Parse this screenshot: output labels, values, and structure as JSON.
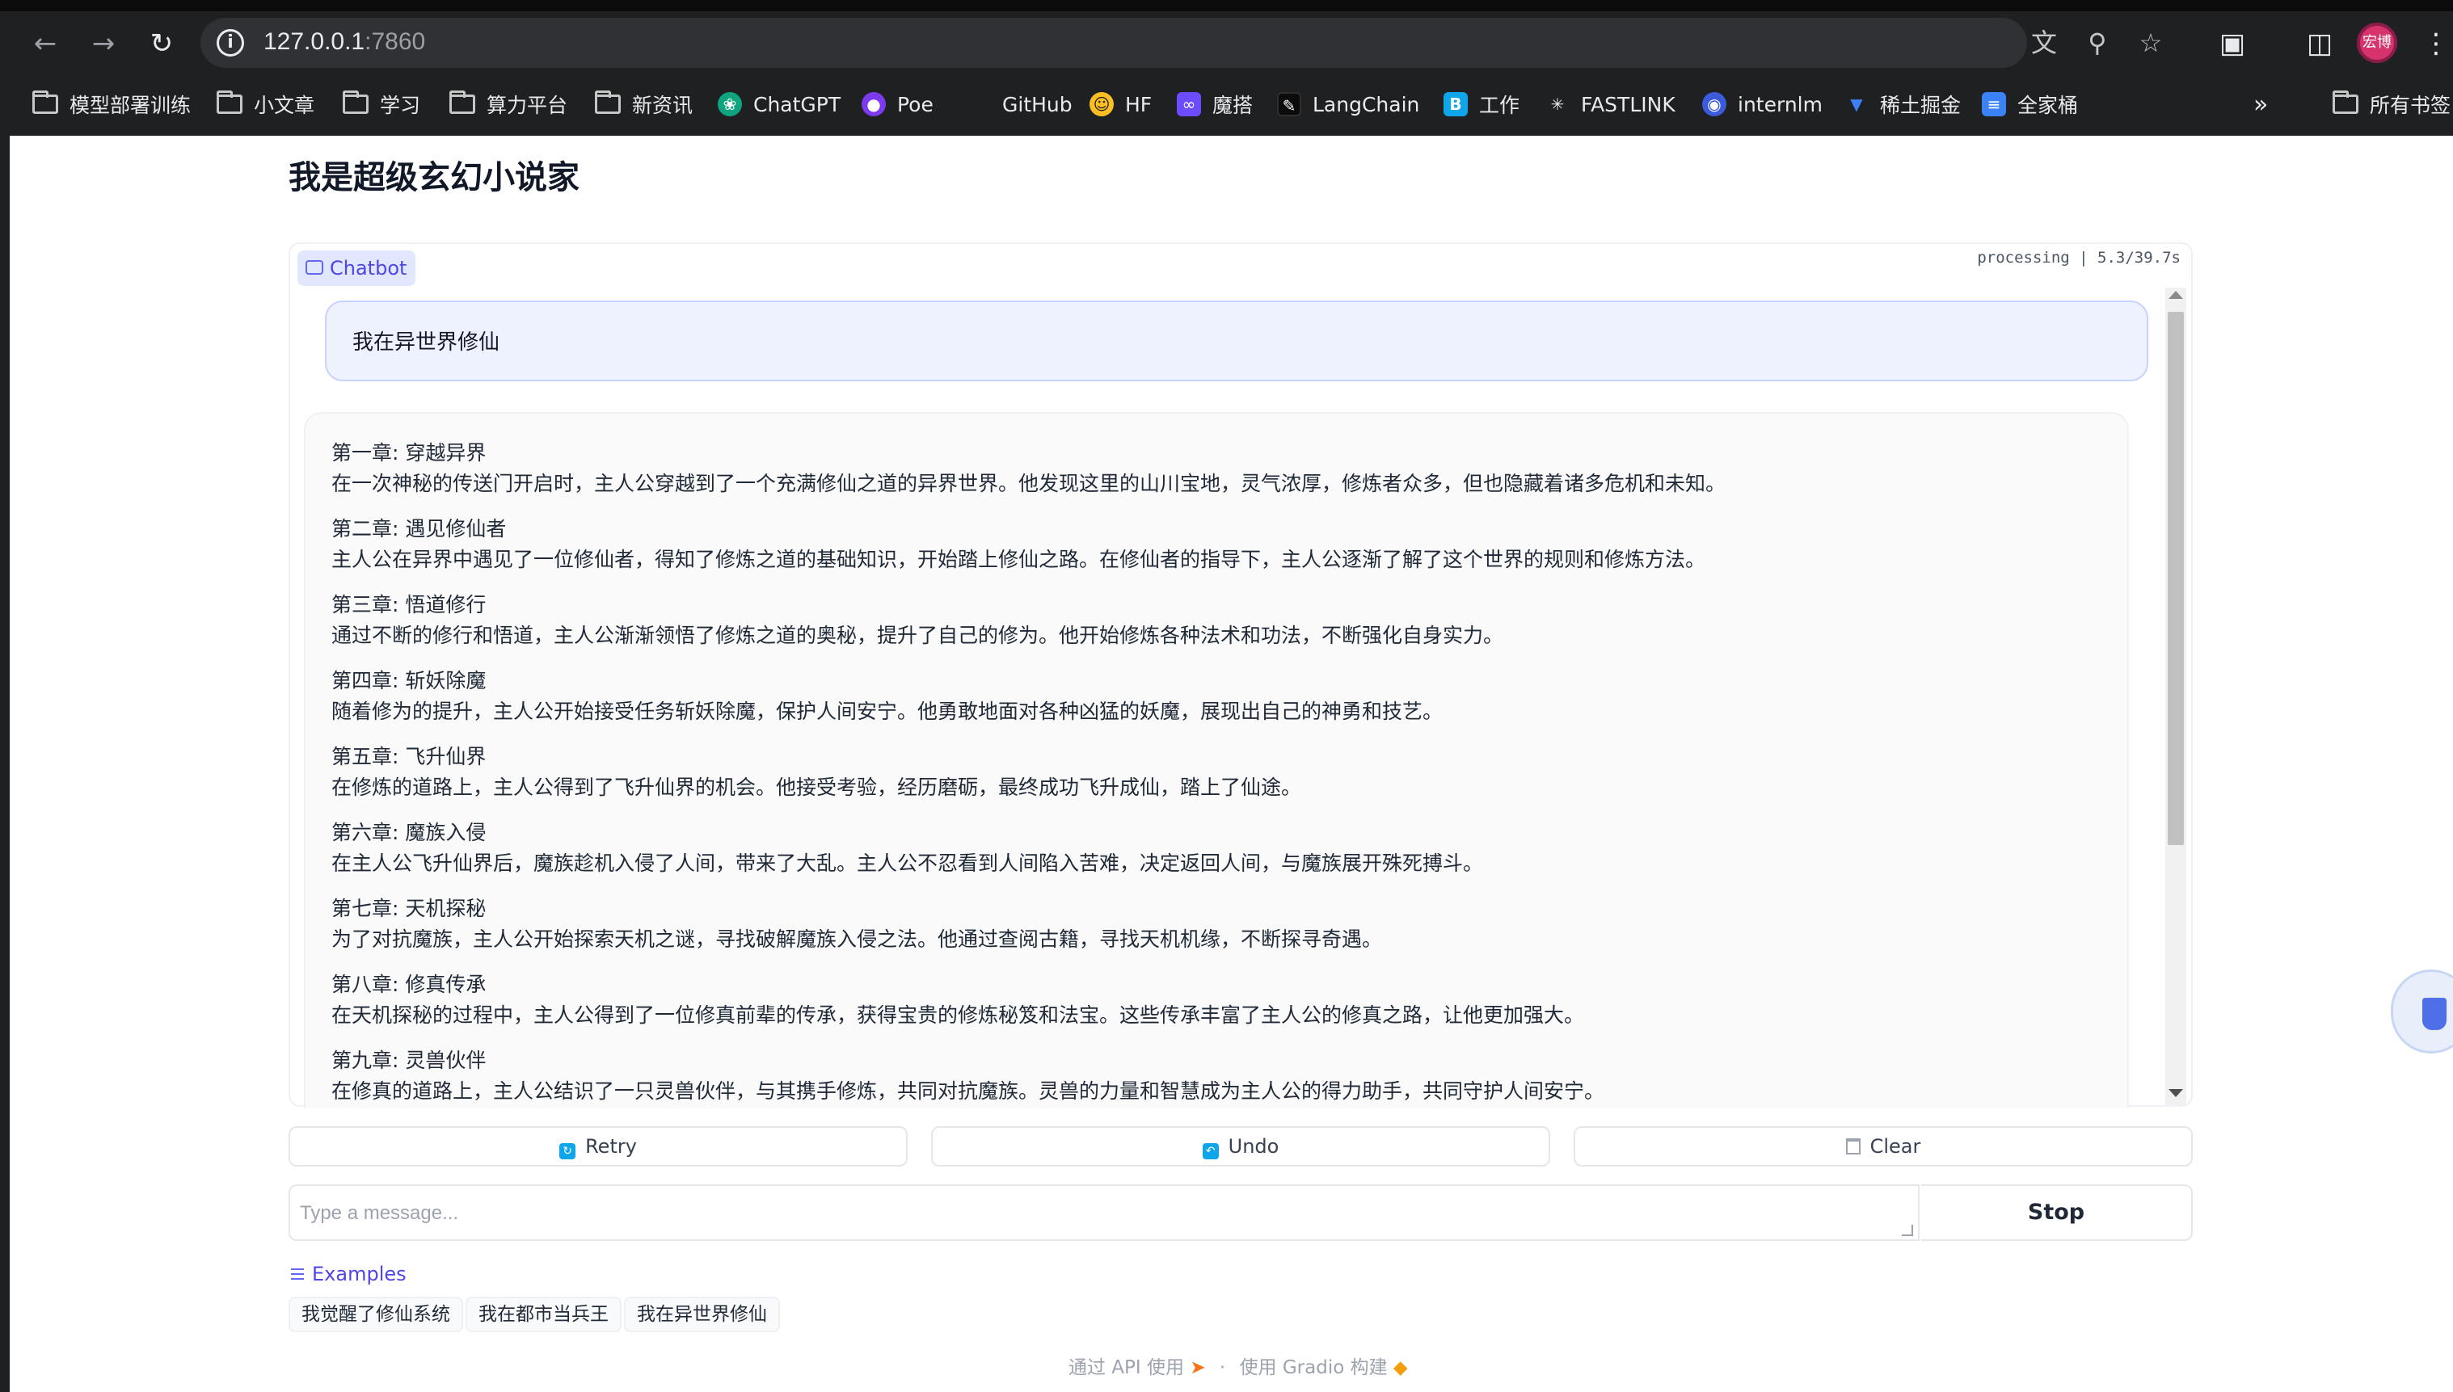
{
  "browser": {
    "url_host": "127.0.0.1",
    "url_port": ":7860",
    "avatar_text": "宏博",
    "bookmarks": [
      {
        "label": "模型部署训练",
        "icon": "folder-icon"
      },
      {
        "label": "小文章",
        "icon": "folder-icon"
      },
      {
        "label": "学习",
        "icon": "folder-icon"
      },
      {
        "label": "算力平台",
        "icon": "folder-icon"
      },
      {
        "label": "新资讯",
        "icon": "folder-icon"
      },
      {
        "label": "ChatGPT",
        "icon": "chatgpt-icon"
      },
      {
        "label": "Poe",
        "icon": "poe-icon"
      },
      {
        "label": "GitHub",
        "icon": "github-icon"
      },
      {
        "label": "HF",
        "icon": "huggingface-icon"
      },
      {
        "label": "魔搭",
        "icon": "modelscope-icon"
      },
      {
        "label": "LangChain",
        "icon": "langchain-icon"
      },
      {
        "label": "工作",
        "icon": "b-icon"
      },
      {
        "label": "FASTLINK",
        "icon": "fastlink-icon"
      },
      {
        "label": "internlm",
        "icon": "internlm-icon"
      },
      {
        "label": "稀土掘金",
        "icon": "juejin-icon"
      },
      {
        "label": "全家桶",
        "icon": "doc-icon"
      }
    ],
    "all_bookmarks": "所有书签"
  },
  "page": {
    "title": "我是超级玄幻小说家"
  },
  "chatbot": {
    "label": "Chatbot",
    "status": "processing | 5.3/39.7s",
    "user_message": "我在异世界修仙",
    "bot_chapters": [
      {
        "title": "第一章: 穿越异界",
        "body": "在一次神秘的传送门开启时，主人公穿越到了一个充满修仙之道的异界世界。他发现这里的山川宝地，灵气浓厚，修炼者众多，但也隐藏着诸多危机和未知。"
      },
      {
        "title": "第二章: 遇见修仙者",
        "body": "主人公在异界中遇见了一位修仙者，得知了修炼之道的基础知识，开始踏上修仙之路。在修仙者的指导下，主人公逐渐了解了这个世界的规则和修炼方法。"
      },
      {
        "title": "第三章: 悟道修行",
        "body": "通过不断的修行和悟道，主人公渐渐领悟了修炼之道的奥秘，提升了自己的修为。他开始修炼各种法术和功法，不断强化自身实力。"
      },
      {
        "title": "第四章: 斩妖除魔",
        "body": "随着修为的提升，主人公开始接受任务斩妖除魔，保护人间安宁。他勇敢地面对各种凶猛的妖魔，展现出自己的神勇和技艺。"
      },
      {
        "title": "第五章: 飞升仙界",
        "body": "在修炼的道路上，主人公得到了飞升仙界的机会。他接受考验，经历磨砺，最终成功飞升成仙，踏上了仙途。"
      },
      {
        "title": "第六章: 魔族入侵",
        "body": "在主人公飞升仙界后，魔族趁机入侵了人间，带来了大乱。主人公不忍看到人间陷入苦难，决定返回人间，与魔族展开殊死搏斗。"
      },
      {
        "title": "第七章: 天机探秘",
        "body": "为了对抗魔族，主人公开始探索天机之谜，寻找破解魔族入侵之法。他通过查阅古籍，寻找天机机缘，不断探寻奇遇。"
      },
      {
        "title": "第八章: 修真传承",
        "body": "在天机探秘的过程中，主人公得到了一位修真前辈的传承，获得宝贵的修炼秘笈和法宝。这些传承丰富了主人公的修真之路，让他更加强大。"
      },
      {
        "title": "第九章: 灵兽伙伴",
        "body": "在修真的道路上，主人公结识了一只灵兽伙伴，与其携手修炼，共同对抗魔族。灵兽的力量和智慧成为主人公的得力助手，共同守护人间安宁。"
      }
    ]
  },
  "actions": {
    "retry": "Retry",
    "undo": "Undo",
    "clear": "Clear",
    "stop": "Stop"
  },
  "input": {
    "placeholder": "Type a message...",
    "value": ""
  },
  "examples": {
    "label": "Examples",
    "items": [
      "我觉醒了修仙系统",
      "我在都市当兵王",
      "我在异世界修仙"
    ]
  },
  "footer": {
    "api": "通过 API 使用",
    "built": "使用 Gradio 构建"
  },
  "colors": {
    "accent": "#4f46e5",
    "chrome_bg": "#1f2021",
    "user_bubble": "#eef2ff"
  }
}
